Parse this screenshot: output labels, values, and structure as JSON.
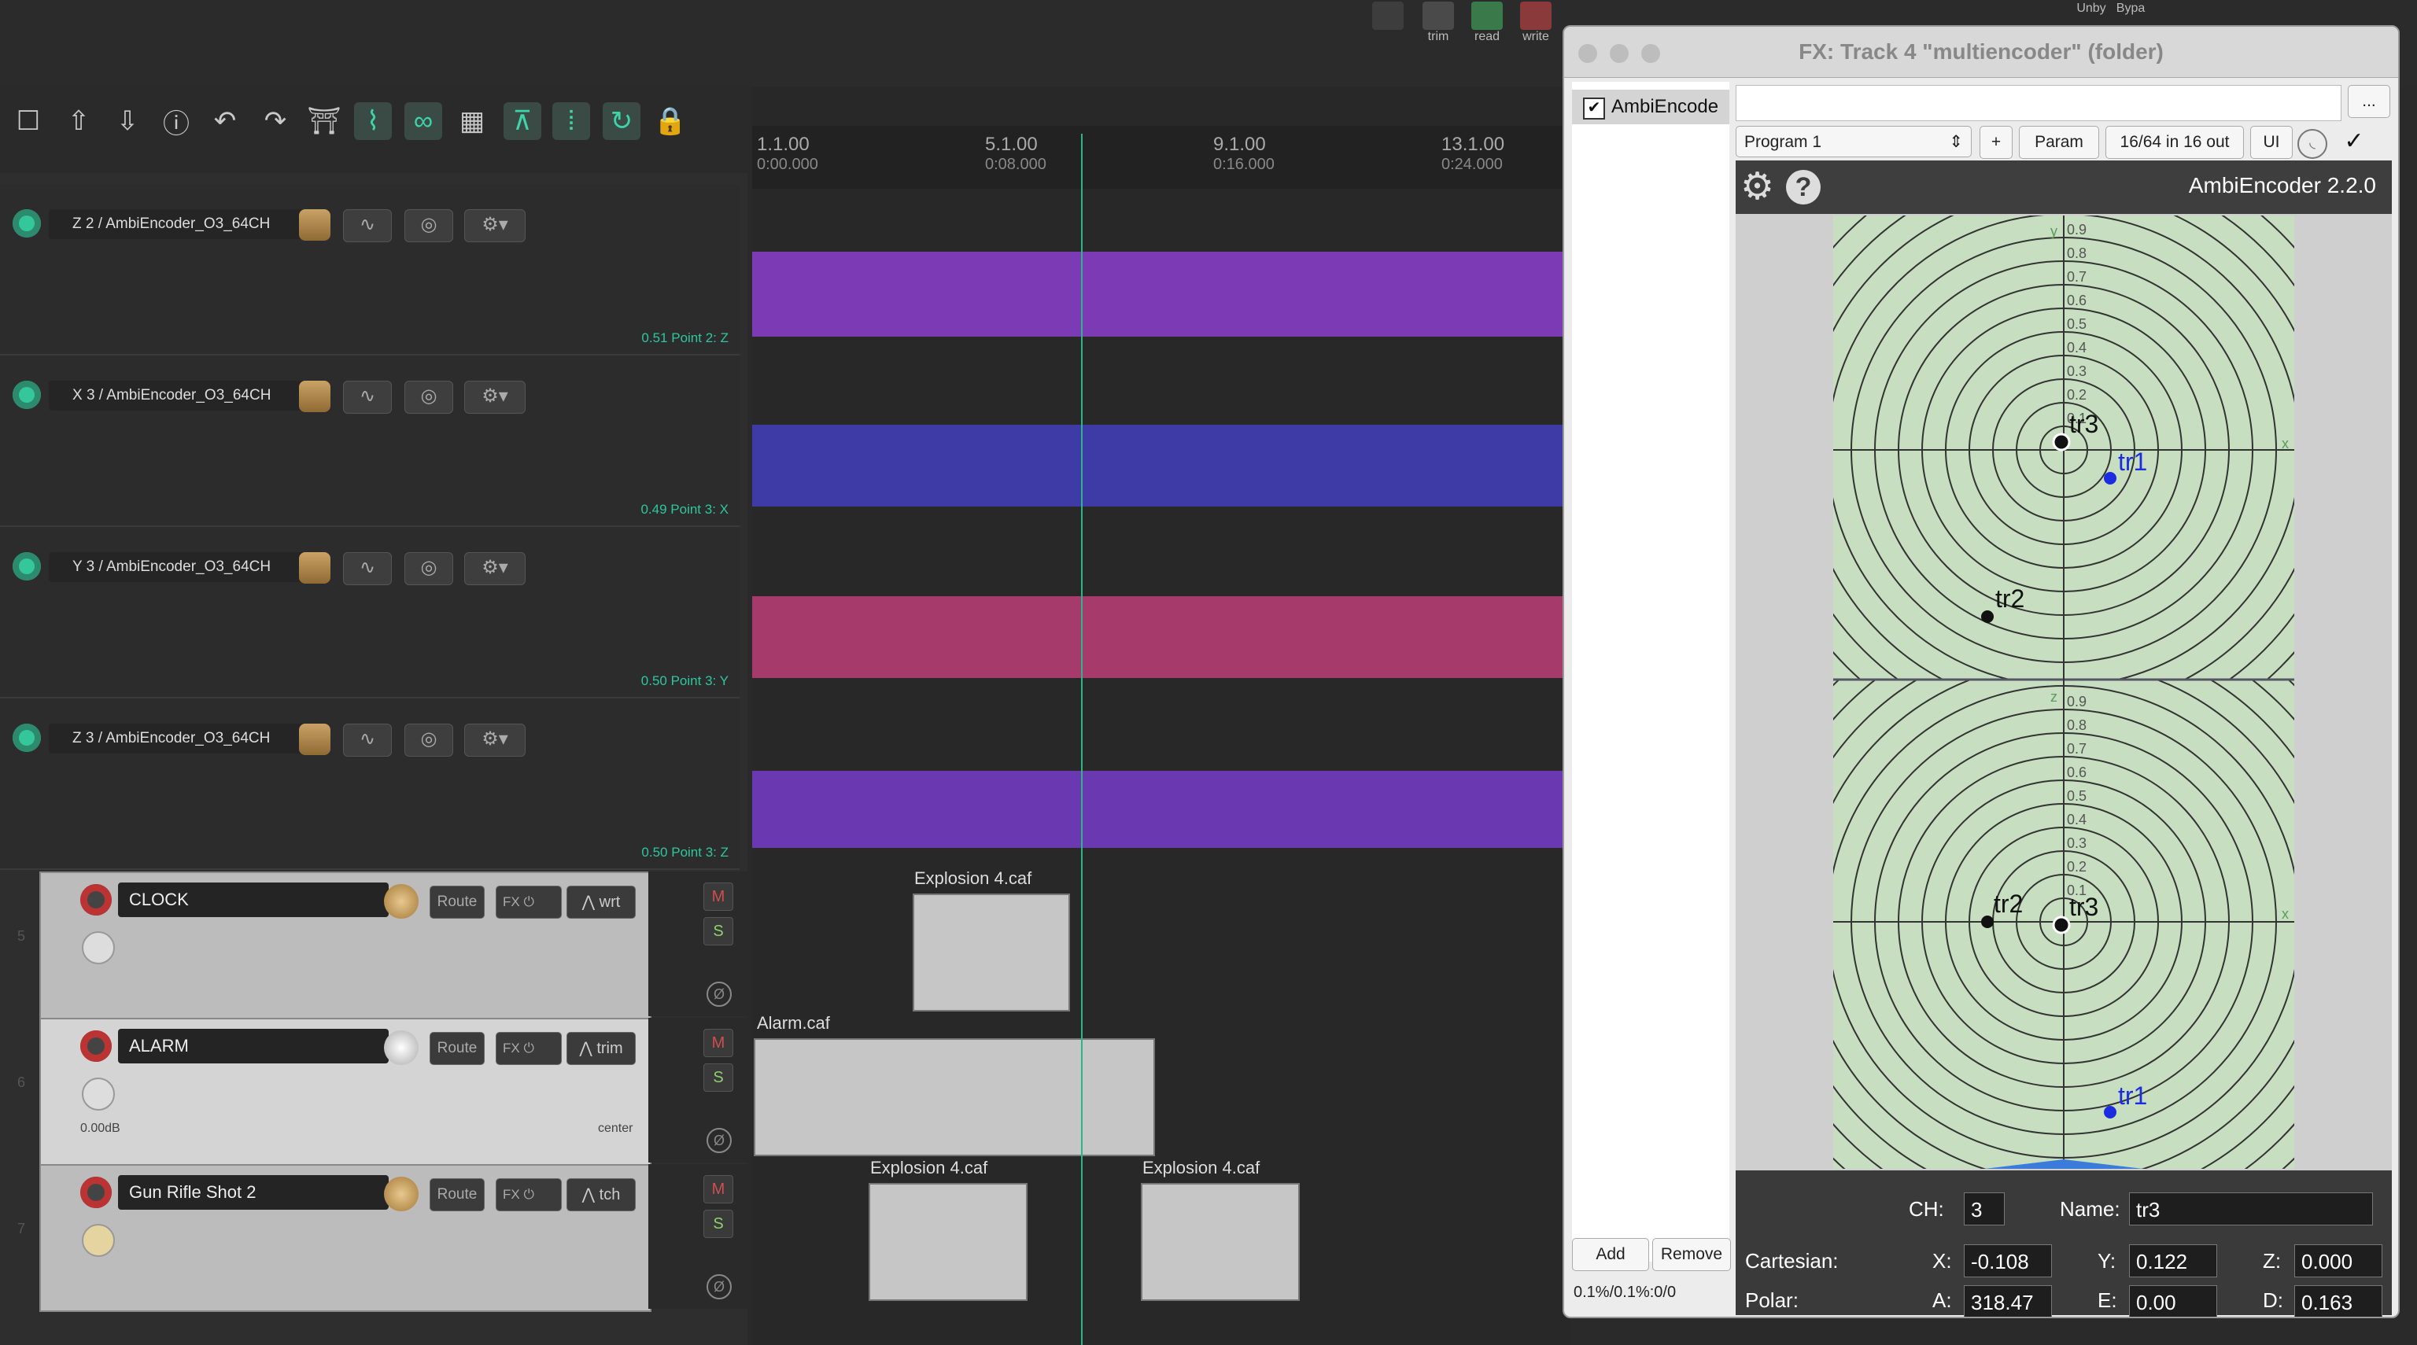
{
  "top_icons": {
    "trim": "trim",
    "read": "read",
    "write": "write",
    "unby": "Unby",
    "bypa": "Bypa"
  },
  "ruler": [
    {
      "bar": "1.1.00",
      "time": "0:00.000"
    },
    {
      "bar": "5.1.00",
      "time": "0:08.000"
    },
    {
      "bar": "9.1.00",
      "time": "0:16.000"
    },
    {
      "bar": "13.1.00",
      "time": "0:24.000"
    }
  ],
  "env_lanes": [
    {
      "title": "Z 2 / AmbiEncoder_O3_64CH",
      "value": "0.51 Point 2: Z",
      "color": "#7c3bb5"
    },
    {
      "title": "X 3 / AmbiEncoder_O3_64CH",
      "value": "0.49 Point 3: X",
      "color": "#3e3aa6"
    },
    {
      "title": "Y 3 / AmbiEncoder_O3_64CH",
      "value": "0.50 Point 3: Y",
      "color": "#a63a6a"
    },
    {
      "title": "Z 3 / AmbiEncoder_O3_64CH",
      "value": "0.50 Point 3: Z",
      "color": "#6a38b0"
    }
  ],
  "tracks": [
    {
      "num": "5",
      "name": "CLOCK",
      "route": "Route",
      "fx": "FX",
      "auto": "wrt",
      "db": "",
      "center": ""
    },
    {
      "num": "6",
      "name": "ALARM",
      "route": "Route",
      "fx": "FX",
      "auto": "trim",
      "db": "0.00dB",
      "center": "center"
    },
    {
      "num": "7",
      "name": "Gun Rifle Shot 2",
      "route": "Route",
      "fx": "FX",
      "auto": "tch",
      "db": "",
      "center": ""
    }
  ],
  "ms": {
    "m": "M",
    "s": "S",
    "ph": "Ø"
  },
  "items": {
    "explosion": "Explosion 4.caf",
    "alarm": "Alarm.caf"
  },
  "fx": {
    "title": "FX: Track 4 \"multiencoder\" (folder)",
    "list_item": "AmbiEncode",
    "program": "Program 1",
    "plus": "+",
    "param": "Param",
    "io": "16/64 in 16 out",
    "ui": "UI",
    "more": "...",
    "add": "Add",
    "remove": "Remove",
    "status": "0.1%/0.1%:0/0",
    "plugin_name": "AmbiEncoder 2.2.0",
    "ch_label": "CH:",
    "ch": "3",
    "name_label": "Name:",
    "name": "tr3",
    "cart_label": "Cartesian:",
    "x_label": "X:",
    "x": "-0.108",
    "y_label": "Y:",
    "y": "0.122",
    "z_label": "Z:",
    "z": "0.000",
    "polar_label": "Polar:",
    "a_label": "A:",
    "a": "318.47",
    "e_label": "E:",
    "e": "0.00",
    "d_label": "D:",
    "d": "0.163"
  },
  "grid_top": {
    "axis_y": "y",
    "axis_x": "x",
    "ticks": [
      "0.9",
      "0.8",
      "0.7",
      "0.6",
      "0.5",
      "0.4",
      "0.3",
      "0.2",
      "0.1"
    ],
    "points": [
      {
        "label": "tr3",
        "color": "#111"
      },
      {
        "label": "tr1",
        "color": "#1a2ee0"
      },
      {
        "label": "tr2",
        "color": "#111"
      }
    ]
  },
  "grid_bottom": {
    "axis_z": "z",
    "axis_x": "x",
    "ticks": [
      "0.9",
      "0.8",
      "0.7",
      "0.6",
      "0.5",
      "0.4",
      "0.3",
      "0.2",
      "0.1"
    ],
    "points": [
      {
        "label": "tr2",
        "color": "#111"
      },
      {
        "label": "tr3",
        "color": "#111"
      },
      {
        "label": "tr1",
        "color": "#1a2ee0"
      }
    ]
  }
}
